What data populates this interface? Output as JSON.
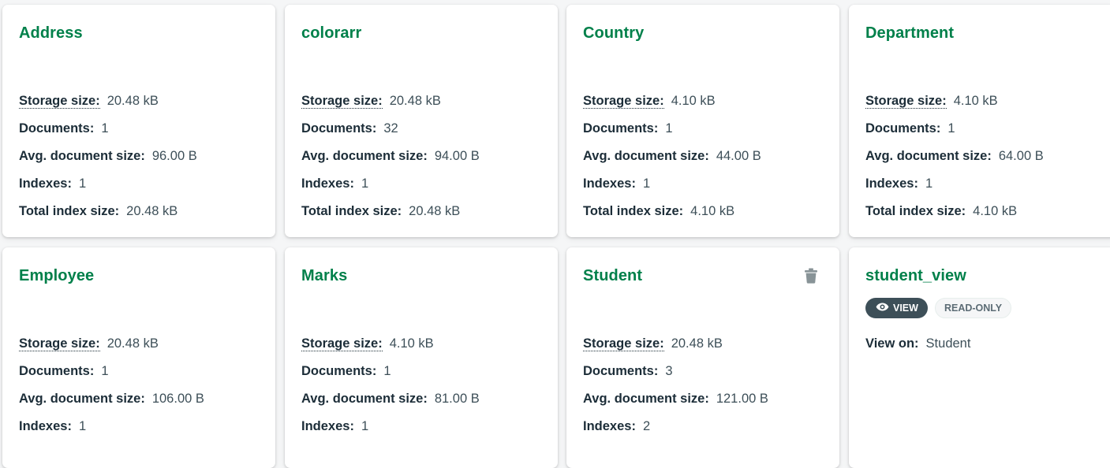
{
  "labels": {
    "storage_size": "Storage size:",
    "documents": "Documents:",
    "avg_document_size": "Avg. document size:",
    "indexes": "Indexes:",
    "total_index_size": "Total index size:",
    "view_on": "View on:"
  },
  "collections": [
    {
      "name": "Address",
      "storage_size": "20.48 kB",
      "documents": "1",
      "avg_document_size": "96.00 B",
      "indexes": "1",
      "total_index_size": "20.48 kB"
    },
    {
      "name": "colorarr",
      "storage_size": "20.48 kB",
      "documents": "32",
      "avg_document_size": "94.00 B",
      "indexes": "1",
      "total_index_size": "20.48 kB"
    },
    {
      "name": "Country",
      "storage_size": "4.10 kB",
      "documents": "1",
      "avg_document_size": "44.00 B",
      "indexes": "1",
      "total_index_size": "4.10 kB"
    },
    {
      "name": "Department",
      "storage_size": "4.10 kB",
      "documents": "1",
      "avg_document_size": "64.00 B",
      "indexes": "1",
      "total_index_size": "4.10 kB"
    },
    {
      "name": "Employee",
      "storage_size": "20.48 kB",
      "documents": "1",
      "avg_document_size": "106.00 B",
      "indexes": "1"
    },
    {
      "name": "Marks",
      "storage_size": "4.10 kB",
      "documents": "1",
      "avg_document_size": "81.00 B",
      "indexes": "1"
    },
    {
      "name": "Student",
      "storage_size": "20.48 kB",
      "documents": "3",
      "avg_document_size": "121.00 B",
      "indexes": "2"
    }
  ],
  "view": {
    "name": "student_view",
    "view_badge": "VIEW",
    "readonly_badge": "READ-ONLY",
    "view_on": "Student"
  },
  "icons": {
    "trash": "trash-icon",
    "eye": "eye-icon"
  },
  "colors": {
    "title_green": "#00804a",
    "badge_dark": "#3d4f58",
    "trash_gray": "#889397"
  }
}
